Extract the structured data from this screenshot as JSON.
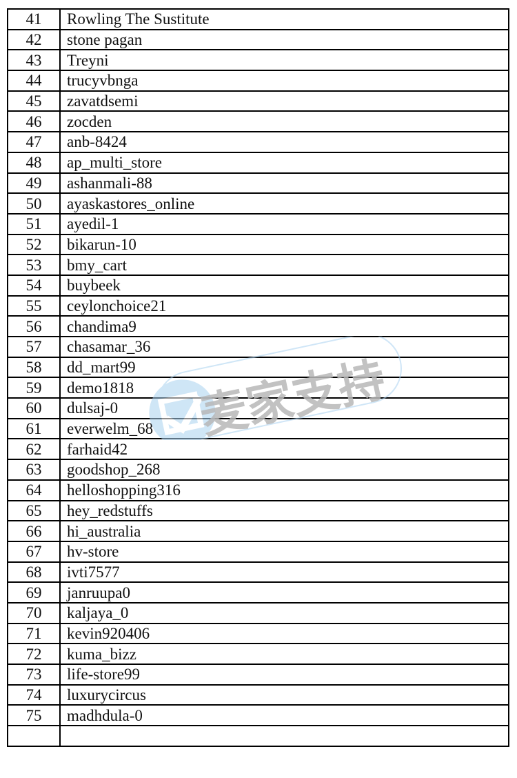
{
  "table": {
    "rows": [
      {
        "num": "41",
        "name": "Rowling The Sustitute"
      },
      {
        "num": "42",
        "name": "stone pagan"
      },
      {
        "num": "43",
        "name": "Treyni"
      },
      {
        "num": "44",
        "name": "trucyvbnga"
      },
      {
        "num": "45",
        "name": "zavatdsemi"
      },
      {
        "num": "46",
        "name": "zocden"
      },
      {
        "num": "47",
        "name": "anb-8424"
      },
      {
        "num": "48",
        "name": "ap_multi_store"
      },
      {
        "num": "49",
        "name": "ashanmali-88"
      },
      {
        "num": "50",
        "name": "ayaskastores_online"
      },
      {
        "num": "51",
        "name": "ayedil-1"
      },
      {
        "num": "52",
        "name": "bikarun-10"
      },
      {
        "num": "53",
        "name": "bmy_cart"
      },
      {
        "num": "54",
        "name": "buybeek"
      },
      {
        "num": "55",
        "name": "ceylonchoice21"
      },
      {
        "num": "56",
        "name": "chandima9"
      },
      {
        "num": "57",
        "name": "chasamar_36"
      },
      {
        "num": "58",
        "name": "dd_mart99"
      },
      {
        "num": "59",
        "name": "demo1818"
      },
      {
        "num": "60",
        "name": "dulsaj-0"
      },
      {
        "num": "61",
        "name": "everwelm_68"
      },
      {
        "num": "62",
        "name": "farhaid42"
      },
      {
        "num": "63",
        "name": "goodshop_268"
      },
      {
        "num": "64",
        "name": "helloshopping316"
      },
      {
        "num": "65",
        "name": "hey_redstuffs"
      },
      {
        "num": "66",
        "name": "hi_australia"
      },
      {
        "num": "67",
        "name": "hv-store"
      },
      {
        "num": "68",
        "name": "ivti7577"
      },
      {
        "num": "69",
        "name": "janruupa0"
      },
      {
        "num": "70",
        "name": "kaljaya_0"
      },
      {
        "num": "71",
        "name": "kevin920406"
      },
      {
        "num": "72",
        "name": "kuma_bizz"
      },
      {
        "num": "73",
        "name": "life-store99"
      },
      {
        "num": "74",
        "name": "luxurycircus"
      },
      {
        "num": "75",
        "name": "madhdula-0"
      },
      {
        "num": "",
        "name": ""
      }
    ]
  },
  "watermark": {
    "text": "麦家支持",
    "text_color": "#b8b8b8",
    "accent_color": "#a9d2f0"
  }
}
